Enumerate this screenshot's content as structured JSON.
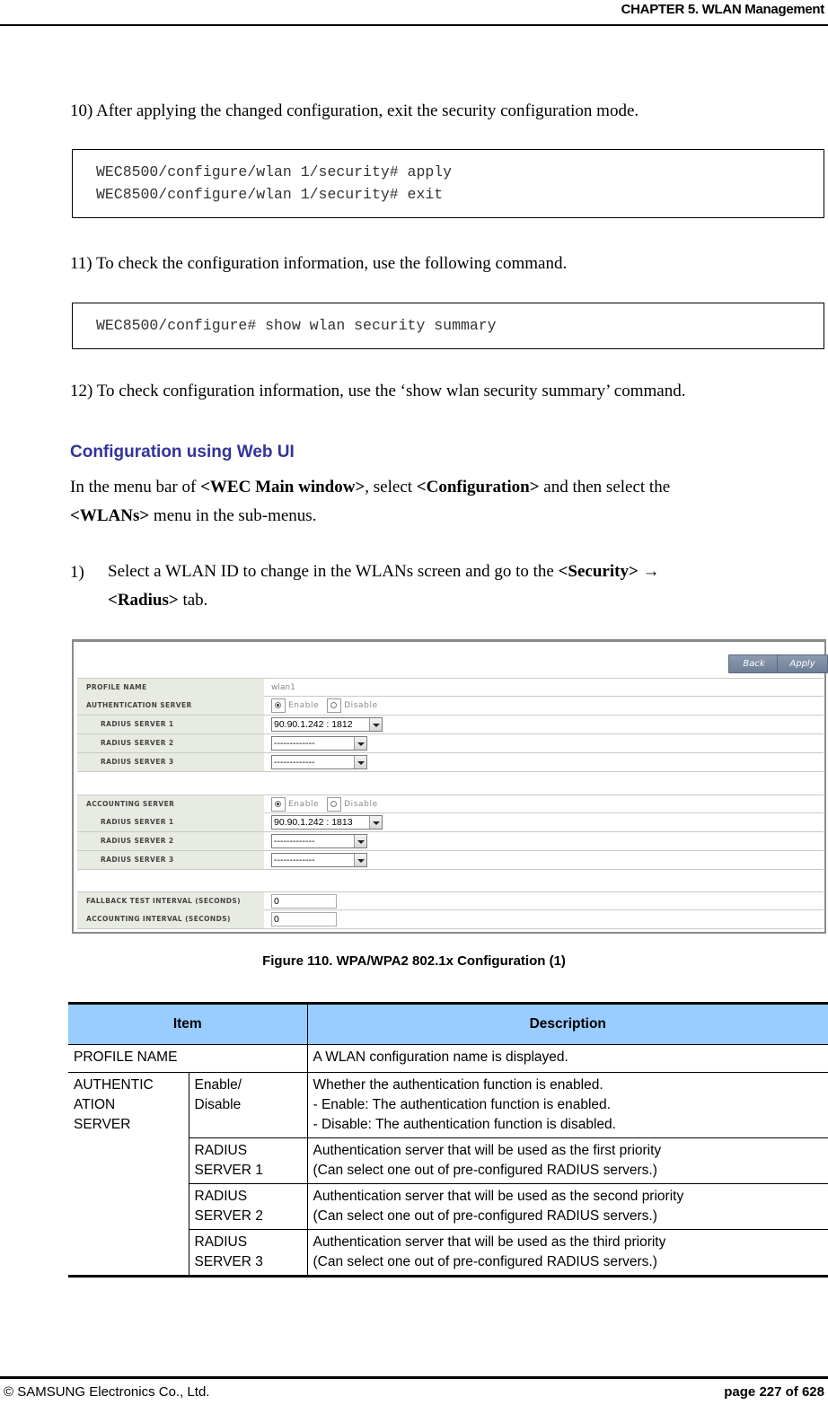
{
  "header": {
    "chapter_title": "CHAPTER 5. WLAN Management"
  },
  "steps": {
    "step10": "10) After applying the changed configuration, exit the security configuration mode.",
    "code1": [
      "WEC8500/configure/wlan 1/security# apply",
      "WEC8500/configure/wlan 1/security# exit"
    ],
    "step11": "11) To check the configuration information, use the following command.",
    "code2": [
      "WEC8500/configure# show wlan security summary"
    ],
    "step12": "12) To check configuration information, use the ‘show wlan security summary’ command."
  },
  "section": {
    "title": "Configuration using Web UI",
    "intro_part1": "In the menu bar of ",
    "intro_bold1": "<WEC Main window>",
    "intro_part2": ", select ",
    "intro_bold2": "<Configuration>",
    "intro_part3": " and then select the",
    "intro_bold3": "<WLANs>",
    "intro_part4": " menu in the sub-menus.",
    "step1_num": "1)",
    "step1_part1": "Select a WLAN ID to change in the WLANs screen and go to the ",
    "step1_bold1": "<Security>",
    "step1_arrow": " → ",
    "step1_bold2": "<Radius>",
    "step1_part2": " tab."
  },
  "screenshot": {
    "buttons": {
      "back": "Back",
      "apply": "Apply"
    },
    "profile_name_label": "PROFILE NAME",
    "profile_name_value": "wlan1",
    "auth_server_label": "AUTHENTICATION SERVER",
    "enable_label": "Enable",
    "disable_label": "Disable",
    "auth_radius": [
      {
        "label": "RADIUS SERVER 1",
        "value": "90.90.1.242 : 1812"
      },
      {
        "label": "RADIUS SERVER 2",
        "value": "-------------"
      },
      {
        "label": "RADIUS SERVER 3",
        "value": "-------------"
      }
    ],
    "acct_server_label": "ACCOUNTING SERVER",
    "acct_radius": [
      {
        "label": "RADIUS SERVER 1",
        "value": "90.90.1.242 : 1813"
      },
      {
        "label": "RADIUS SERVER 2",
        "value": "-------------"
      },
      {
        "label": "RADIUS SERVER 3",
        "value": "-------------"
      }
    ],
    "fallback_label": "FALLBACK TEST INTERVAL (SECONDS)",
    "fallback_value": "0",
    "acct_interval_label": "ACCOUNTING INTERVAL (SECONDS)",
    "acct_interval_value": "0"
  },
  "figure_caption": "Figure 110. WPA/WPA2 802.1x Configuration (1)",
  "table": {
    "headers": [
      "Item",
      "Description"
    ],
    "profile_name": {
      "item": "PROFILE NAME",
      "desc": "A WLAN configuration name is displayed."
    },
    "auth_group": "AUTHENTIC ATION SERVER",
    "auth_group_lines": [
      "AUTHENTIC",
      "ATION",
      "SERVER"
    ],
    "rows": [
      {
        "sub_lines": [
          "Enable/",
          "Disable"
        ],
        "desc_lines": [
          "Whether the authentication function is enabled.",
          "- Enable: The authentication function is enabled.",
          "- Disable: The authentication function is disabled."
        ]
      },
      {
        "sub_lines": [
          "RADIUS",
          "SERVER 1"
        ],
        "desc_lines": [
          "Authentication server that will be used as the first priority",
          "(Can select one out of pre-configured RADIUS servers.)"
        ]
      },
      {
        "sub_lines": [
          "RADIUS",
          "SERVER 2"
        ],
        "desc_lines": [
          "Authentication server that will be used as the second priority",
          "(Can select one out of pre-configured RADIUS servers.)"
        ]
      },
      {
        "sub_lines": [
          "RADIUS",
          "SERVER 3"
        ],
        "desc_lines": [
          "Authentication server that will be used as the third priority",
          "(Can select one out of pre-configured RADIUS servers.)"
        ]
      }
    ]
  },
  "footer": {
    "copyright": "© SAMSUNG Electronics Co., Ltd.",
    "page": "page 227 of 628"
  }
}
